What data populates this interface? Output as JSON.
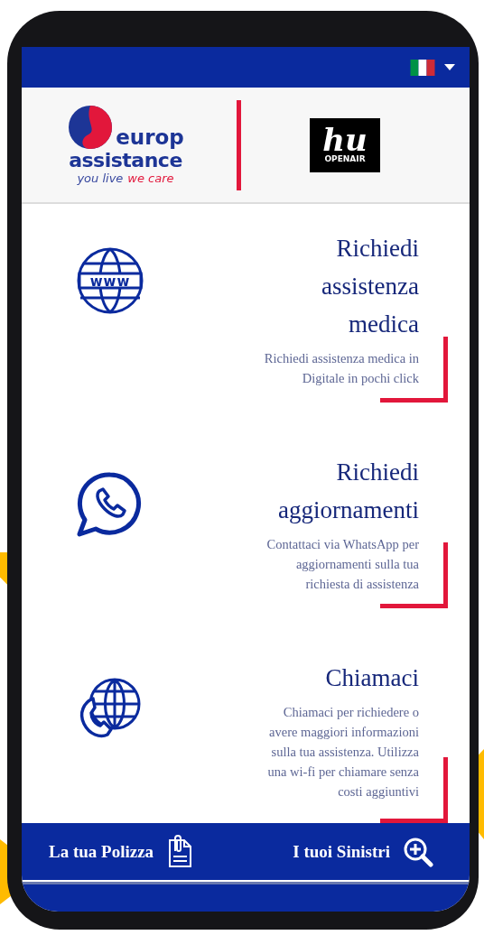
{
  "header": {
    "brand_logo": {
      "word_1": "europ",
      "word_2": "assistance",
      "tagline_1": "you live",
      "tagline_2": "we care"
    },
    "partner_logo": {
      "mark": "hu",
      "caption": "OPENAIR"
    }
  },
  "services": [
    {
      "kind": "web",
      "icon_text": "www",
      "title_lines": [
        "Richiedi",
        "assistenza",
        "medica"
      ],
      "description_lines": [
        "Richiedi  assistenza medica in",
        "Digitale in pochi click"
      ]
    },
    {
      "kind": "chat",
      "title_lines": [
        "Richiedi",
        "aggiornamenti"
      ],
      "description_lines": [
        "Contattaci via WhatsApp per",
        "aggiornamenti sulla tua",
        "richiesta di assistenza"
      ]
    },
    {
      "kind": "call",
      "title_lines": [
        "Chiamaci"
      ],
      "description_lines": [
        "Chiamaci per richiedere o",
        "avere maggiori informazioni",
        "sulla tua assistenza. Utilizza",
        "una wi-fi per chiamare senza",
        "costi aggiuntivi"
      ]
    }
  ],
  "bottom_nav": [
    {
      "kind": "policy",
      "label": "La tua Polizza"
    },
    {
      "kind": "claims",
      "label": "I tuoi Sinistri"
    }
  ]
}
